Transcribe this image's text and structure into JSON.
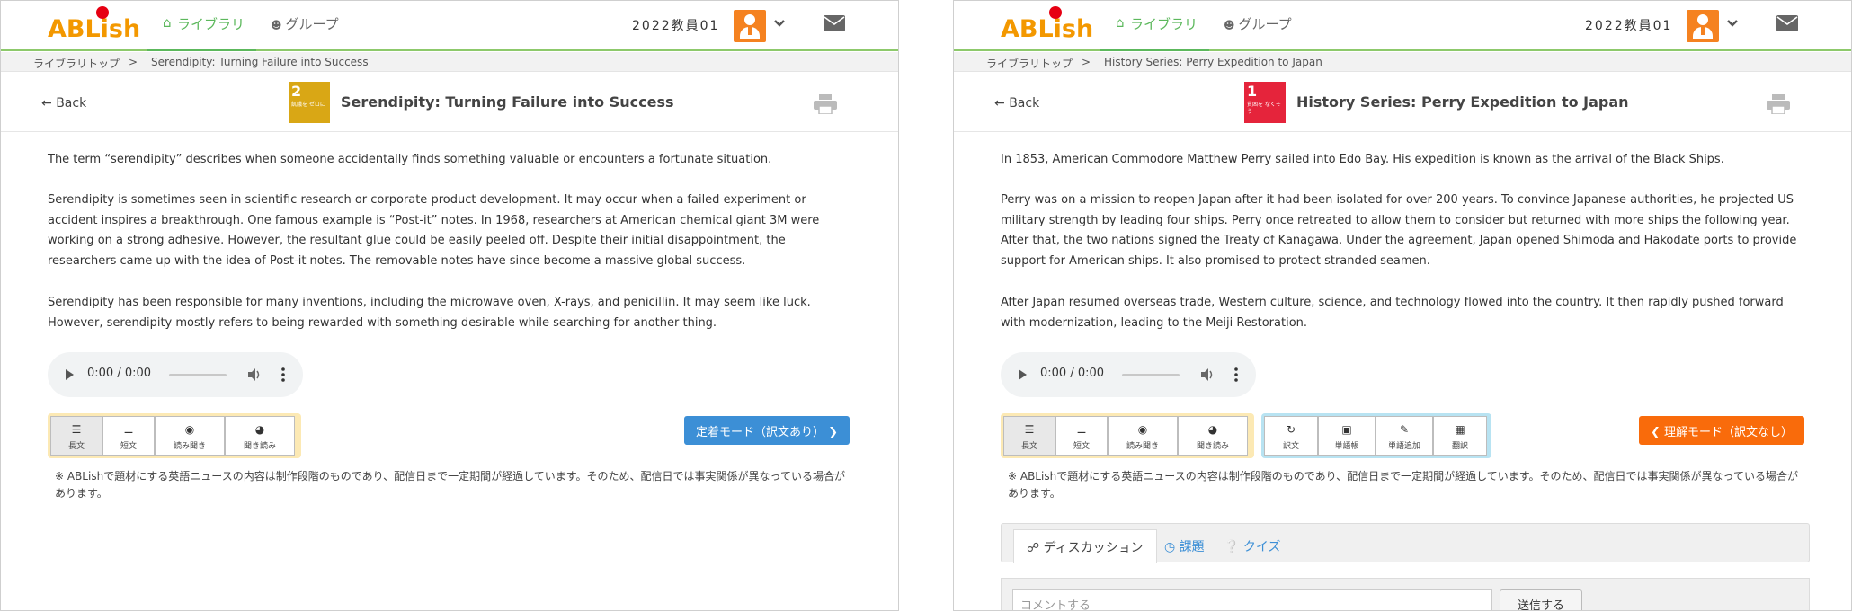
{
  "colors": {
    "brand_orange": "#f39800",
    "brand_red": "#e60012",
    "nav_green": "#5cb85c",
    "sdg2_yellow": "#d9a715",
    "sdg1_red": "#e5243b",
    "mode_blue": "#3c8fd6",
    "mode_orange": "#f96b0b"
  },
  "panels": [
    {
      "header": {
        "logo": "ABLish",
        "nav_library": "ライブラリ",
        "nav_group": "グループ",
        "user_name": "2022教員01"
      },
      "breadcrumb": {
        "top": "ライブラリトップ",
        "sep": ">",
        "current": "Serendipity: Turning Failure into Success"
      },
      "title": {
        "back": "Back",
        "sdg_number": "2",
        "sdg_small": "飢餓を ゼロに",
        "text": "Serendipity: Turning Failure into Success"
      },
      "paragraphs": [
        "The term “serendipity” describes when someone accidentally finds something valuable or encounters a fortunate situation.",
        "Serendipity is sometimes seen in scientific research or corporate product development. It may occur when a failed experiment or accident inspires a breakthrough. One famous example is “Post-it” notes. In 1968, researchers at American chemical giant 3M were working on a strong adhesive. However, the resultant glue could be easily peeled off. Despite their initial disappointment, the researchers came up with the idea of Post-it notes. The removable notes have since become a massive global success.",
        "Serendipity has been responsible for many inventions, including the microwave oven, X-rays, and penicillin. It may seem like luck. However, serendipity mostly refers to being rewarded with something desirable while searching for another thing."
      ],
      "audio_time": "0:00 / 0:00",
      "reading_buttons": [
        {
          "icon": "long-text-icon",
          "label": "長文"
        },
        {
          "icon": "short-text-icon",
          "label": "短文"
        },
        {
          "icon": "eye-icon",
          "label": "読み聞き"
        },
        {
          "icon": "gauge-icon",
          "label": "聞き読み"
        }
      ],
      "mode_button": "定着モード（訳文あり）",
      "note": "※ ABLishで題材にする英語ニュースの内容は制作段階のものであり、配信日まで一定期間が経過しています。そのため、配信日では事実関係が異なっている場合があります。"
    },
    {
      "header": {
        "logo": "ABLish",
        "nav_library": "ライブラリ",
        "nav_group": "グループ",
        "user_name": "2022教員01"
      },
      "breadcrumb": {
        "top": "ライブラリトップ",
        "sep": ">",
        "current": "History Series: Perry Expedition to Japan"
      },
      "title": {
        "back": "Back",
        "sdg_number": "1",
        "sdg_small": "貧困を なくそう",
        "text": "History Series: Perry Expedition to Japan"
      },
      "paragraphs": [
        "In 1853, American Commodore Matthew Perry sailed into Edo Bay. His expedition is known as the arrival of the Black Ships.",
        "Perry was on a mission to reopen Japan after it had been isolated for over 200 years. To convince Japanese authorities, he projected US military strength by leading four ships. Perry once retreated to allow them to consider but returned with more ships the following year. After that, the two nations signed the Treaty of Kanagawa. Under the agreement, Japan opened Shimoda and Hakodate ports to provide support for American ships. It also promised to protect stranded seamen.",
        "After Japan resumed overseas trade, Western culture, science, and technology flowed into the country. It then rapidly pushed forward with modernization, leading to the Meiji Restoration."
      ],
      "audio_time": "0:00 / 0:00",
      "reading_buttons": [
        {
          "icon": "long-text-icon",
          "label": "長文"
        },
        {
          "icon": "short-text-icon",
          "label": "短文"
        },
        {
          "icon": "eye-icon",
          "label": "読み聞き"
        },
        {
          "icon": "gauge-icon",
          "label": "聞き読み"
        }
      ],
      "tool_buttons": [
        {
          "icon": "refresh-icon",
          "label": "訳文"
        },
        {
          "icon": "book-icon",
          "label": "単語帳"
        },
        {
          "icon": "add-word-icon",
          "label": "単語追加"
        },
        {
          "icon": "translate-icon",
          "label": "翻訳"
        }
      ],
      "mode_button": "理解モード（訳文なし）",
      "note": "※ ABLishで題材にする英語ニュースの内容は制作段階のものであり、配信日まで一定期間が経過しています。そのため、配信日では事実関係が異なっている場合があります。",
      "tabs": {
        "discussion": "ディスカッション",
        "assignment": "課題",
        "quiz": "クイズ"
      },
      "comment_placeholder": "コメントする",
      "send_button": "送信する"
    }
  ]
}
